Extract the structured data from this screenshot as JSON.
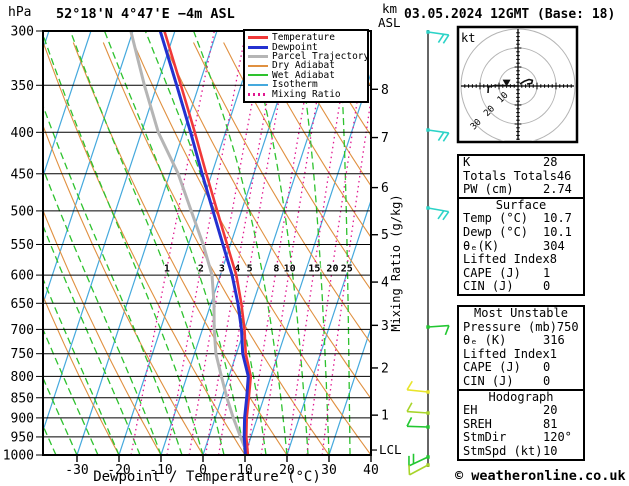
{
  "header": {
    "pressure_unit": "hPa",
    "station": "52°18'N 4°47'E −4m ASL",
    "datetime": "03.05.2024 12GMT (Base: 18)",
    "altitude_unit_line1": "km",
    "altitude_unit_line2": "ASL"
  },
  "legend": {
    "items": [
      {
        "label": "Temperature",
        "color": "#f03838",
        "style": "solid"
      },
      {
        "label": "Dewpoint",
        "color": "#2431d0",
        "style": "solid"
      },
      {
        "label": "Parcel Trajectory",
        "color": "#b5b5b5",
        "style": "solid"
      },
      {
        "label": "Dry Adiabat",
        "color": "#e09040",
        "style": "thin"
      },
      {
        "label": "Wet Adiabat",
        "color": "#2ec22e",
        "style": "thin"
      },
      {
        "label": "Isotherm",
        "color": "#45a9dd",
        "style": "thin"
      },
      {
        "label": "Mixing Ratio",
        "color": "#e01890",
        "style": "dotted"
      }
    ]
  },
  "axes": {
    "pressure_ticks": [
      300,
      350,
      400,
      450,
      500,
      550,
      600,
      650,
      700,
      750,
      800,
      850,
      900,
      950,
      1000
    ],
    "temp_ticks": [
      -30,
      -20,
      -10,
      0,
      10,
      20,
      30,
      40
    ],
    "xlabel": "Dewpoint / Temperature (°C)",
    "km_ticks": [
      {
        "km": 8,
        "p": 354
      },
      {
        "km": 7,
        "p": 406
      },
      {
        "km": 6,
        "p": 468
      },
      {
        "km": 5,
        "p": 535
      },
      {
        "km": 4,
        "p": 612
      },
      {
        "km": 3,
        "p": 692
      },
      {
        "km": 2,
        "p": 781
      },
      {
        "km": 1,
        "p": 893
      }
    ],
    "lcl": {
      "label": "LCL",
      "p": 986
    },
    "right_axis_label": "Mixing Ratio (g/kg)",
    "mixing_ratio_values": [
      1,
      2,
      3,
      4,
      5,
      8,
      10,
      15,
      20,
      25
    ],
    "mixing_ratio_label_pressure": 588
  },
  "chart_data": {
    "type": "line",
    "title": "Skew-T log-P sounding",
    "xlabel": "Dewpoint / Temperature (°C)",
    "ylabel": "hPa",
    "xlim": [
      -40,
      40
    ],
    "p_top": 300,
    "p_bottom": 1000,
    "pressure_levels": [
      1000,
      950,
      900,
      850,
      800,
      750,
      700,
      650,
      600,
      550,
      500,
      450,
      400,
      350,
      300
    ],
    "series": [
      {
        "name": "Temperature",
        "color": "#f03838",
        "width": 2.6,
        "values": [
          10.7,
          8.9,
          7.5,
          6.4,
          5.2,
          2.2,
          0.0,
          -2.8,
          -6.2,
          -10.8,
          -15.8,
          -21.3,
          -27.3,
          -34.3,
          -42.5
        ]
      },
      {
        "name": "Dewpoint",
        "color": "#2431d0",
        "width": 3,
        "values": [
          10.1,
          8.4,
          7.0,
          5.9,
          4.6,
          1.5,
          -0.7,
          -3.6,
          -7.2,
          -11.8,
          -16.8,
          -22.3,
          -28.3,
          -35.3,
          -43.5
        ]
      },
      {
        "name": "Parcel Trajectory",
        "color": "#b5b5b5",
        "width": 3,
        "values": [
          10.7,
          7.5,
          4.3,
          1.2,
          -1.8,
          -4.9,
          -7.2,
          -9.3,
          -12.0,
          -16.5,
          -22.0,
          -28.0,
          -36.0,
          -43.0,
          -50.5
        ]
      }
    ],
    "background": {
      "isotherm_step": 10,
      "dry_adiabat_step": 10,
      "wet_adiabat_step": 5,
      "colors": {
        "isotherm": "#45a9dd",
        "dry_adiabat": "#e09040",
        "wet_adiabat": "#2ec22e",
        "mixing_ratio": "#e01890",
        "grid": "#000000"
      }
    }
  },
  "indices": {
    "summary": {
      "rows": [
        [
          "K",
          "28"
        ],
        [
          "Totals Totals",
          "46"
        ],
        [
          "PW (cm)",
          "2.74"
        ]
      ]
    },
    "surface": {
      "title": "Surface",
      "rows": [
        [
          "Temp (°C)",
          "10.7"
        ],
        [
          "Dewp (°C)",
          "10.1"
        ],
        [
          "θₑ(K)",
          "304"
        ],
        [
          "Lifted Index",
          "8"
        ],
        [
          "CAPE (J)",
          "1"
        ],
        [
          "CIN (J)",
          "0"
        ]
      ]
    },
    "most_unstable": {
      "title": "Most Unstable",
      "rows": [
        [
          "Pressure (mb)",
          "750"
        ],
        [
          "θₑ (K)",
          "316"
        ],
        [
          "Lifted Index",
          "1"
        ],
        [
          "CAPE (J)",
          "0"
        ],
        [
          "CIN (J)",
          "0"
        ]
      ]
    },
    "hodograph_stats": {
      "title": "Hodograph",
      "rows": [
        [
          "EH",
          "20"
        ],
        [
          "SREH",
          "81"
        ],
        [
          "StmDir",
          "120°"
        ],
        [
          "StmSpd (kt)",
          "10"
        ]
      ]
    }
  },
  "hodograph": {
    "unit_label": "kt",
    "ring_values": [
      10,
      20,
      30
    ],
    "trace_main": [
      [
        -15.8,
        -3.7
      ],
      [
        -15.6,
        -0.5
      ],
      [
        -12,
        0.3
      ],
      [
        -8,
        0.2
      ],
      [
        -4,
        0.1
      ],
      [
        0,
        0
      ]
    ],
    "trace_upper": [
      [
        1,
        1
      ],
      [
        3.5,
        2.6
      ],
      [
        5.8,
        3.4
      ],
      [
        7.6,
        3.0
      ],
      [
        7.2,
        1.4
      ],
      [
        4.8,
        1.0
      ]
    ],
    "storm_motion": [
      -6,
      1.8
    ]
  },
  "wind_barbs": [
    {
      "y": 32,
      "color": "#2bd3c7",
      "angle": 8,
      "feathers": 2
    },
    {
      "y": 130,
      "color": "#2bd3c7",
      "angle": 8,
      "feathers": 2
    },
    {
      "y": 208,
      "color": "#2bd3c7",
      "angle": 10,
      "feathers": 2
    },
    {
      "y": 327,
      "color": "#22c731",
      "angle": -4,
      "feathers": 1
    },
    {
      "y": 392,
      "color": "#e9e52b",
      "angle": 186,
      "feathers": 1
    },
    {
      "y": 413,
      "color": "#a8d42a",
      "angle": 184,
      "feathers": 1
    },
    {
      "y": 427,
      "color": "#22c731",
      "angle": 182,
      "feathers": 1
    },
    {
      "y": 457,
      "color": "#22c731",
      "angle": 155,
      "feathers": 2
    },
    {
      "y": 465,
      "color": "#a8d42a",
      "angle": 152,
      "feathers": 1
    }
  ],
  "footer": {
    "copyright": "© weatheronline.co.uk"
  }
}
